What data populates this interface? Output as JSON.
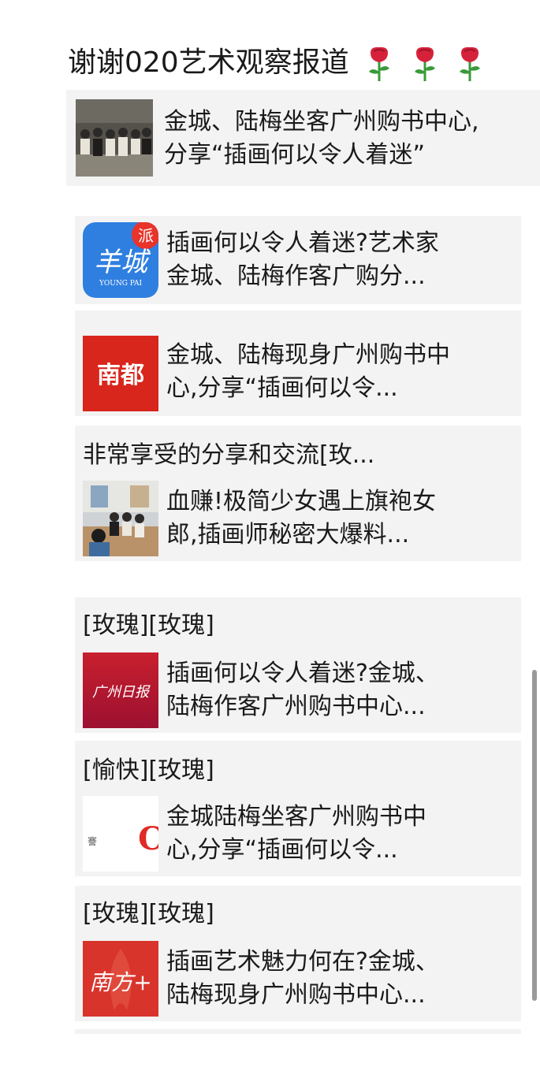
{
  "header": {
    "title": "谢谢020艺术观察报道"
  },
  "cards": [
    {
      "title": "金城、陆梅坐客广州购书中心,\n分享“插画何以令人着迷”"
    },
    {
      "title": "插画何以令人着迷?艺术家\n金城、陆梅作客广购分...",
      "logo_text": "羊城",
      "logo_sub": "YOUNG PAI",
      "logo_badge": "派"
    },
    {
      "title": "金城、陆梅现身广州购书中\n心,分享“插画何以令...",
      "logo_text": "南都"
    },
    {
      "comment": "非常享受的分享和交流[玫...",
      "title": "血赚!极简少女遇上旗袍女\n郎,插画师秘密大爆料..."
    },
    {
      "comment": "[玫瑰][玫瑰]",
      "title": "插画何以令人着迷?金城、\n陆梅作客广州购书中心...",
      "logo_text": "广州日报"
    },
    {
      "comment": "[愉快][玫瑰]",
      "title": "金城陆梅坐客广州购书中\n心,分享“插画何以令...",
      "logo_text": "C",
      "logo_side": "謇"
    },
    {
      "comment": "[玫瑰][玫瑰]",
      "title": "插画艺术魅力何在?金城、\n陆梅现身广州购书中心...",
      "logo_text": "南方+"
    }
  ],
  "colors": {
    "rose_red": "#d6213a",
    "yangcheng_blue": "#2f7fe0",
    "nandu_red": "#d9261c",
    "gzrb_red": "#b8162c",
    "nanfang_red": "#d8342c"
  }
}
